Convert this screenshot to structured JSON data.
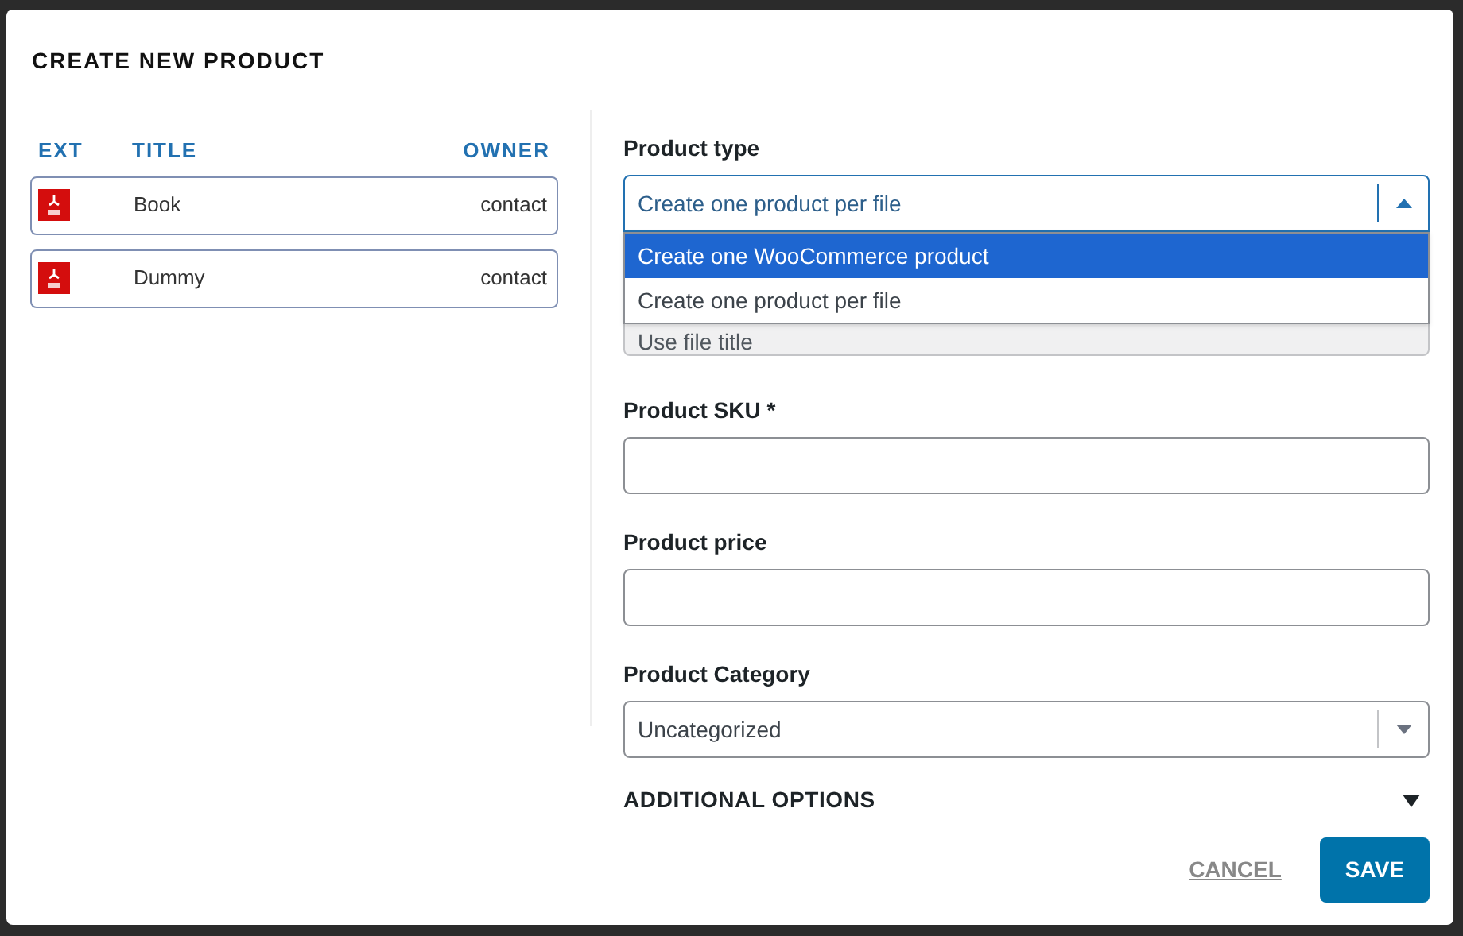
{
  "dialog": {
    "title": "CREATE NEW PRODUCT"
  },
  "files": {
    "columns": [
      "EXT",
      "TITLE",
      "OWNER"
    ],
    "rows": [
      {
        "title": "Book",
        "owner": "contact"
      },
      {
        "title": "Dummy",
        "owner": "contact"
      }
    ]
  },
  "product_type": {
    "label": "Product type",
    "value": "Create one product per file",
    "expanded": true,
    "options": [
      {
        "label": "Create one WooCommerce product",
        "highlighted": true
      },
      {
        "label": "Create one product per file",
        "highlighted": false
      }
    ]
  },
  "product_title": {
    "value": "Use file title",
    "disabled": true
  },
  "product_sku": {
    "label": "Product SKU *"
  },
  "product_price": {
    "label": "Product price"
  },
  "product_category": {
    "label": "Product Category",
    "value": "Uncategorized",
    "expanded": false
  },
  "additional_options": {
    "label": "ADDITIONAL OPTIONS",
    "expanded": false
  },
  "buttons": {
    "cancel": "CANCEL",
    "save": "SAVE"
  }
}
